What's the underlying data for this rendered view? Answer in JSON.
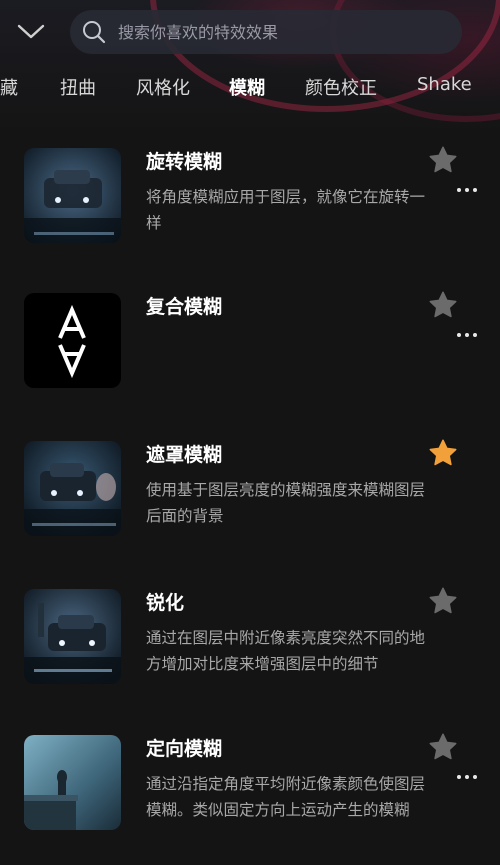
{
  "search": {
    "placeholder": "搜索你喜欢的特效效果"
  },
  "tabs": [
    {
      "label": "藏",
      "active": false
    },
    {
      "label": "扭曲",
      "active": false
    },
    {
      "label": "风格化",
      "active": false
    },
    {
      "label": "模糊",
      "active": true
    },
    {
      "label": "颜色校正",
      "active": false
    },
    {
      "label": "Shake",
      "active": false
    }
  ],
  "effects": [
    {
      "title": "旋转模糊",
      "description": "将角度模糊应用于图层，就像它在旋转一样",
      "favorited": false
    },
    {
      "title": "复合模糊",
      "description": "",
      "favorited": false
    },
    {
      "title": "遮罩模糊",
      "description": "使用基于图层亮度的模糊强度来模糊图层后面的背景",
      "favorited": true
    },
    {
      "title": "锐化",
      "description": "通过在图层中附近像素亮度突然不同的地方增加对比度来增强图层中的细节",
      "favorited": false
    },
    {
      "title": "定向模糊",
      "description": "通过沿指定角度平均附近像素颜色使图层模糊。类似固定方向上运动产生的模糊",
      "favorited": false
    }
  ],
  "colors": {
    "background": "#141414",
    "star_inactive": "#6b6b6b",
    "star_active": "#f2a13a",
    "text_secondary": "#a8a8a8"
  },
  "icons": {
    "back": "chevron-down-icon",
    "search": "search-icon",
    "favorite": "star-icon",
    "more": "more-icon"
  }
}
